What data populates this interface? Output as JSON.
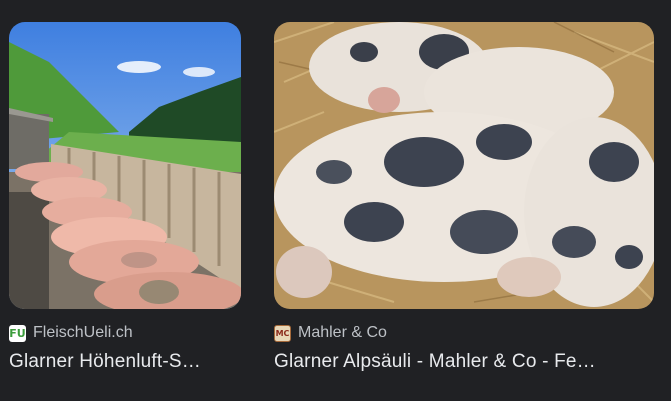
{
  "results": [
    {
      "source": "FleischUeli.ch",
      "favicon": "FU",
      "title": "Glarner Höhenluft-S…"
    },
    {
      "source": "Mahler & Co",
      "favicon": "MC",
      "title": "Glarner Alpsäuli - Mahler & Co - Fe…"
    }
  ]
}
